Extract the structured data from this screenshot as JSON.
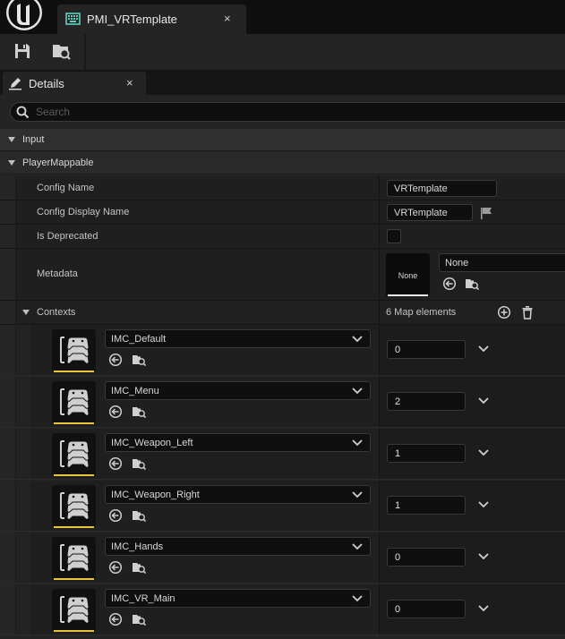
{
  "editor": {
    "tab_title": "PMI_VRTemplate",
    "tab_close": "×",
    "logo_icon": "unreal-engine-logo-icon",
    "tab_icon": "input-mapping-asset-icon"
  },
  "toolbar": {
    "buttons": [
      {
        "name": "save-button",
        "icon": "save-icon"
      },
      {
        "name": "browse-to-asset-button",
        "icon": "browse-folder-icon"
      }
    ]
  },
  "details_tab": {
    "label": "Details",
    "close": "×",
    "icon": "pencil-icon"
  },
  "search": {
    "placeholder": "Search",
    "icon": "search-icon"
  },
  "categories": {
    "input": "Input",
    "player_mappable": "PlayerMappable"
  },
  "properties": {
    "config_name": {
      "label": "Config Name",
      "value": "VRTemplate"
    },
    "config_display_name": {
      "label": "Config Display Name",
      "value": "VRTemplate"
    },
    "is_deprecated": {
      "label": "Is Deprecated",
      "checked": false
    },
    "metadata": {
      "label": "Metadata",
      "thumb_label": "None",
      "value": "None"
    }
  },
  "contexts": {
    "label": "Contexts",
    "count_text": "6 Map elements",
    "elements": [
      {
        "name": "IMC_Default",
        "value": "0"
      },
      {
        "name": "IMC_Menu",
        "value": "2"
      },
      {
        "name": "IMC_Weapon_Left",
        "value": "1"
      },
      {
        "name": "IMC_Weapon_Right",
        "value": "1"
      },
      {
        "name": "IMC_Hands",
        "value": "0"
      },
      {
        "name": "IMC_VR_Main",
        "value": "0"
      }
    ]
  },
  "colors": {
    "accent_yellow": "#e8c53a",
    "thumb_bar_white": "#e8e8e8",
    "tab_icon_teal": "#5fd0c0"
  }
}
